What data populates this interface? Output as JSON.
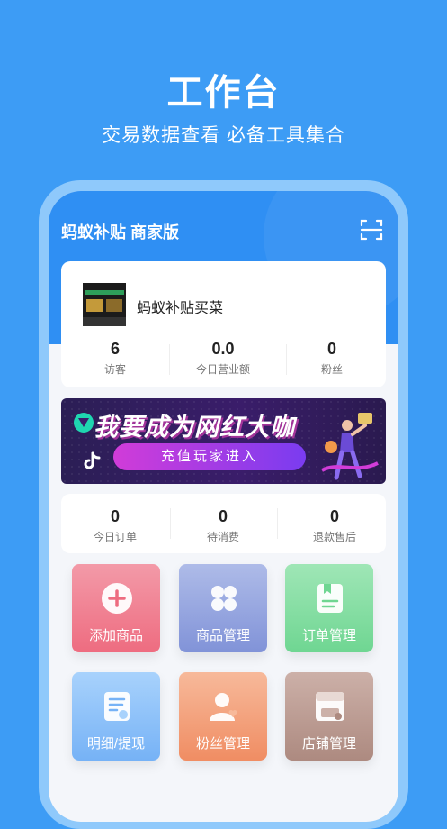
{
  "promo": {
    "title": "工作台",
    "subtitle": "交易数据查看 必备工具集合"
  },
  "app": {
    "title": "蚂蚁补贴 商家版",
    "scan_icon": "scan-icon"
  },
  "store": {
    "name": "蚂蚁补贴买菜",
    "stats": [
      {
        "value": "6",
        "label": "访客"
      },
      {
        "value": "0.0",
        "label": "今日营业额"
      },
      {
        "value": "0",
        "label": "粉丝"
      }
    ]
  },
  "banner": {
    "headline": "我要成为网红大咖",
    "button": "充值玩家进入"
  },
  "orders": {
    "stats": [
      {
        "value": "0",
        "label": "今日订单"
      },
      {
        "value": "0",
        "label": "待消费"
      },
      {
        "value": "0",
        "label": "退款售后"
      }
    ]
  },
  "tools": [
    {
      "label": "添加商品",
      "icon": "plus-circle-icon",
      "color": "#ee6c80"
    },
    {
      "label": "商品管理",
      "icon": "grid-petals-icon",
      "color": "#8193d8"
    },
    {
      "label": "订单管理",
      "icon": "document-icon",
      "color": "#6fd692"
    },
    {
      "label": "明细/提现",
      "icon": "statement-icon",
      "color": "#76b2f6"
    },
    {
      "label": "粉丝管理",
      "icon": "user-heart-icon",
      "color": "#f08d63"
    },
    {
      "label": "店铺管理",
      "icon": "store-icon",
      "color": "#ad8a80"
    }
  ]
}
